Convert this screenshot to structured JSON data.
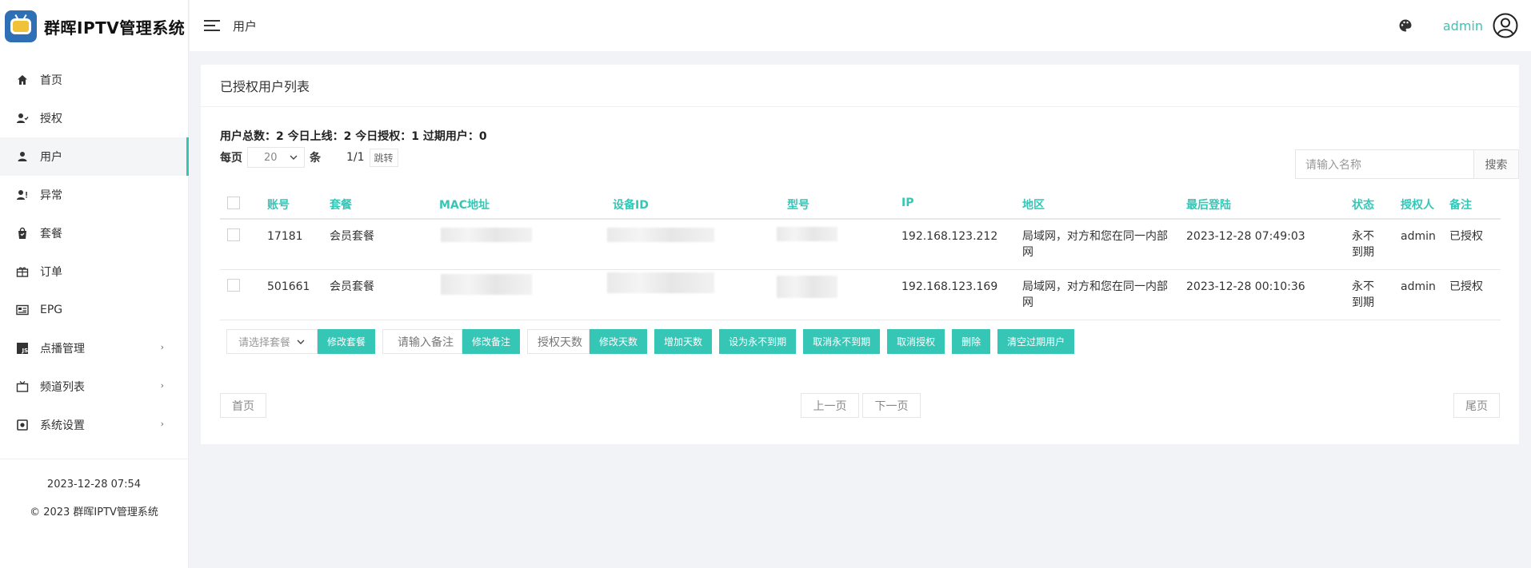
{
  "app": {
    "title": "群晖IPTV管理系统"
  },
  "sidebar": {
    "items": [
      {
        "label": "首页",
        "icon": "home-icon"
      },
      {
        "label": "授权",
        "icon": "user-check-icon"
      },
      {
        "label": "用户",
        "icon": "user-icon",
        "active": true
      },
      {
        "label": "异常",
        "icon": "user-warning-icon"
      },
      {
        "label": "套餐",
        "icon": "bag-icon"
      },
      {
        "label": "订单",
        "icon": "gift-icon"
      },
      {
        "label": "EPG",
        "icon": "epg-icon"
      },
      {
        "label": "点播管理",
        "icon": "js-icon",
        "arrow": "›"
      },
      {
        "label": "频道列表",
        "icon": "tv-icon",
        "arrow": "›"
      },
      {
        "label": "系统设置",
        "icon": "settings-icon",
        "arrow": "›"
      }
    ],
    "footer_time": "2023-12-28 07:54",
    "footer_copy": "© 2023 群晖IPTV管理系统"
  },
  "header": {
    "breadcrumb": "用户",
    "admin": "admin"
  },
  "card": {
    "title": "已授权用户列表",
    "stats": "用户总数：2 今日上线：2 今日授权：1 过期用户：0",
    "perpage_label": "每页",
    "perpage_value": "20",
    "perpage_unit": "条",
    "page_info": "1/1",
    "jump_label": "跳转"
  },
  "search": {
    "placeholder": "请输入名称",
    "button": "搜索"
  },
  "table": {
    "headers": [
      "账号",
      "套餐",
      "MAC地址",
      "设备ID",
      "型号",
      "IP",
      "地区",
      "最后登陆",
      "状态",
      "授权人",
      "备注"
    ],
    "rows": [
      {
        "account": "17181",
        "package": "会员套餐",
        "ip": "192.168.123.212",
        "region": "局域网，对方和您在同一内部网",
        "last_login": "2023-12-28 07:49:03",
        "status": "永不到期",
        "authorizer": "admin",
        "note": "已授权"
      },
      {
        "account": "501661",
        "package": "会员套餐",
        "ip": "192.168.123.169",
        "region": "局域网，对方和您在同一内部网",
        "last_login": "2023-12-28 00:10:36",
        "status": "永不到期",
        "authorizer": "admin",
        "note": "已授权"
      }
    ]
  },
  "actions": {
    "package_select": "请选择套餐",
    "modify_package": "修改套餐",
    "note_placeholder": "请输入备注",
    "modify_note": "修改备注",
    "days_placeholder": "授权天数",
    "modify_days": "修改天数",
    "add_days": "增加天数",
    "set_permanent": "设为永不到期",
    "cancel_permanent": "取消永不到期",
    "cancel_auth": "取消授权",
    "delete": "删除",
    "clear_expired": "清空过期用户"
  },
  "pager": {
    "first": "首页",
    "prev": "上一页",
    "next": "下一页",
    "last": "尾页"
  },
  "colors": {
    "accent": "#35c6b6",
    "brand": "#2f6fb6"
  }
}
